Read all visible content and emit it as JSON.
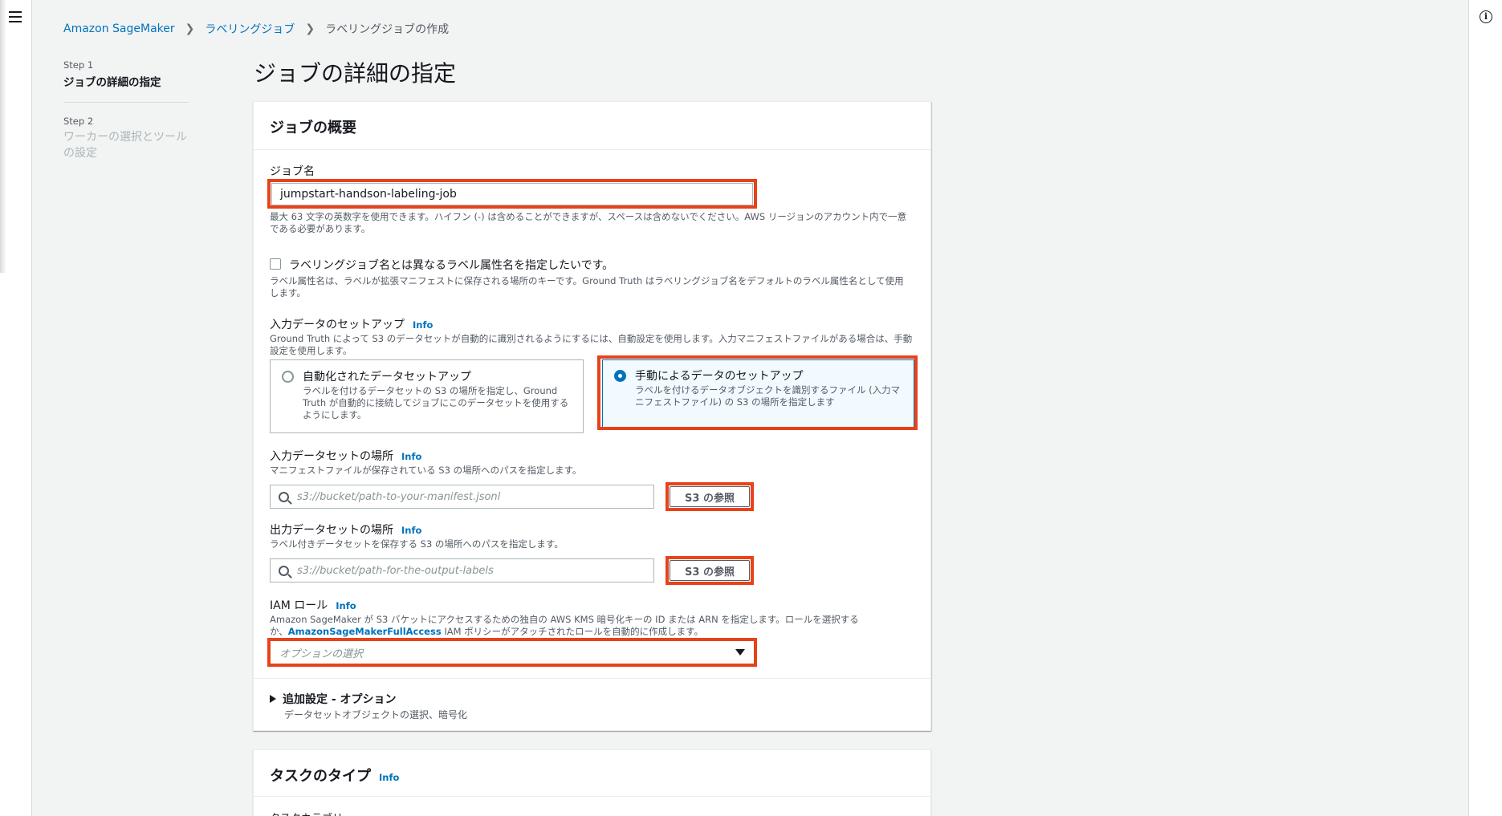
{
  "breadcrumb": {
    "root": "Amazon SageMaker",
    "parent": "ラベリングジョブ",
    "current": "ラベリングジョブの作成"
  },
  "steps": [
    {
      "num": "Step 1",
      "title": "ジョブの詳細の指定"
    },
    {
      "num": "Step 2",
      "title": "ワーカーの選択とツールの設定"
    }
  ],
  "page_title": "ジョブの詳細の指定",
  "overview": {
    "header": "ジョブの概要",
    "job_name": {
      "label": "ジョブ名",
      "value": "jumpstart-handson-labeling-job",
      "help": "最大 63 文字の英数字を使用できます。ハイフン (-) は含めることができますが、スペースは含めないでください。AWS リージョンのアカウント内で一意である必要があります。"
    },
    "label_attr": {
      "checkbox_label": "ラベリングジョブ名とは異なるラベル属性名を指定したいです。",
      "help": "ラベル属性名は、ラベルが拡張マニフェストに保存される場所のキーです。Ground Truth はラベリングジョブ名をデフォルトのラベル属性名として使用します。"
    },
    "input_setup": {
      "label": "入力データのセットアップ",
      "info": "Info",
      "help": "Ground Truth によって S3 のデータセットが自動的に識別されるようにするには、自動設定を使用します。入力マニフェストファイルがある場合は、手動設定を使用します。",
      "options": [
        {
          "title": "自動化されたデータセットアップ",
          "desc": "ラベルを付けるデータセットの S3 の場所を指定し、Ground Truth が自動的に接続してジョブにこのデータセットを使用するようにします。",
          "selected": false
        },
        {
          "title": "手動によるデータのセットアップ",
          "desc": "ラベルを付けるデータオブジェクトを識別するファイル (入力マニフェストファイル) の S3 の場所を指定します",
          "selected": true
        }
      ]
    },
    "input_location": {
      "label": "入力データセットの場所",
      "info": "Info",
      "help": "マニフェストファイルが保存されている S3 の場所へのパスを指定します。",
      "placeholder": "s3://bucket/path-to-your-manifest.jsonl",
      "button": "S3 の参照"
    },
    "output_location": {
      "label": "出力データセットの場所",
      "info": "Info",
      "help": "ラベル付きデータセットを保存する S3 の場所へのパスを指定します。",
      "placeholder": "s3://bucket/path-for-the-output-labels",
      "button": "S3 の参照"
    },
    "iam_role": {
      "label": "IAM ロール",
      "info": "Info",
      "help_pre": "Amazon SageMaker が S3 バケットにアクセスするための独自の AWS KMS 暗号化キーの ID または ARN を指定します。ロールを選択するか、",
      "help_link": "AmazonSageMakerFullAccess",
      "help_post": " IAM ポリシーがアタッチされたロールを自動的に作成します。",
      "placeholder": "オプションの選択"
    },
    "additional": {
      "title": "追加設定 - オプション",
      "desc": "データセットオブジェクトの選択、暗号化"
    }
  },
  "task_type": {
    "header": "タスクのタイプ",
    "info": "Info",
    "cutoff": "タスクカテゴリ"
  },
  "colors": {
    "highlight": "#e8421a",
    "link": "#0073bb",
    "selected_tile_bg": "#f1faff"
  }
}
